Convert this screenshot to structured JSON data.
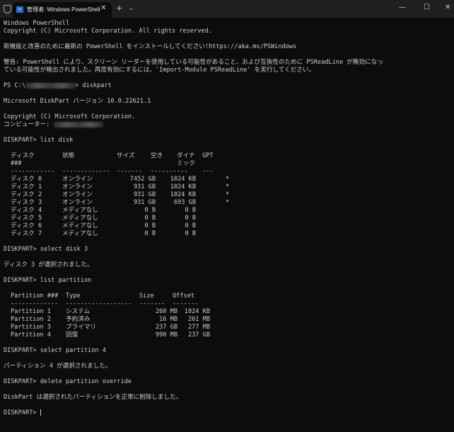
{
  "window": {
    "tab_title": "管理者: Windows PowerShell",
    "tab_close": "✕",
    "new_tab": "+",
    "dropdown": "⌄",
    "minimize": "—",
    "maximize": "☐",
    "close": "✕"
  },
  "intro": [
    "Windows PowerShell",
    "Copyright (C) Microsoft Corporation. All rights reserved.",
    "",
    "新機能と改善のために最新の PowerShell をインストールしてください!https://aka.ms/PSWindows",
    "",
    "警告: PowerShell により、スクリーン リーダーを使用している可能性があること、および互換性のために PSReadLine が無効になっ",
    "ている可能性が検出されました。再度有効にするには、'Import-Module PSReadLine' を実行してください。",
    ""
  ],
  "prompt_line": {
    "prefix": "PS C:\\",
    "suffix": "> diskpart"
  },
  "diskpart_header": [
    "",
    "Microsoft DiskPart バージョン 10.0.22621.1",
    "",
    "Copyright (C) Microsoft Corporation."
  ],
  "computer_label": "コンピューター: ",
  "cmd_list_disk": "DISKPART> list disk",
  "disk_table": {
    "headers": [
      "ディスク",
      "状態",
      "サイズ",
      "空き",
      "ダイナ",
      "GPT"
    ],
    "header2": [
      "###",
      "ミック"
    ],
    "dashes": [
      "------------",
      "-------------",
      "-------",
      "-------",
      "---",
      "---"
    ],
    "rows": [
      [
        "ディスク 0",
        "オンライン",
        "7452 GB",
        "1024 KB",
        "",
        "*"
      ],
      [
        "ディスク 1",
        "オンライン",
        "931 GB",
        "1024 KB",
        "",
        "*"
      ],
      [
        "ディスク 2",
        "オンライン",
        "931 GB",
        "1024 KB",
        "",
        "*"
      ],
      [
        "ディスク 3",
        "オンライン",
        "931 GB",
        "693 GB",
        "",
        "*"
      ],
      [
        "ディスク 4",
        "メディアなし",
        "0 B",
        "0 B",
        "",
        ""
      ],
      [
        "ディスク 5",
        "メディアなし",
        "0 B",
        "0 B",
        "",
        ""
      ],
      [
        "ディスク 6",
        "メディアなし",
        "0 B",
        "0 B",
        "",
        ""
      ],
      [
        "ディスク 7",
        "メディアなし",
        "0 B",
        "0 B",
        "",
        ""
      ]
    ]
  },
  "cmd_select_disk": "DISKPART> select disk 3",
  "msg_disk_selected": "ディスク 3 が選択されました。",
  "cmd_list_partition": "DISKPART> list partition",
  "partition_table": {
    "headers": [
      "Partition ###",
      "Type",
      "Size",
      "Offset"
    ],
    "dashes": [
      "-------------",
      "------------------",
      "-------",
      "-------"
    ],
    "rows": [
      [
        "Partition 1",
        "システム",
        "260 MB",
        "1024 KB"
      ],
      [
        "Partition 2",
        "予約済み",
        "16 MB",
        "261 MB"
      ],
      [
        "Partition 3",
        "プライマリ",
        "237 GB",
        "277 MB"
      ],
      [
        "Partition 4",
        "回復",
        "990 MB",
        "237 GB"
      ]
    ]
  },
  "cmd_select_partition": "DISKPART> select partition 4",
  "msg_partition_selected": "パーティション 4 が選択されました。",
  "cmd_delete": "DISKPART> delete partition override",
  "msg_deleted": "DiskPart は選択されたパーティションを正常に削除しました。",
  "final_prompt": "DISKPART> "
}
